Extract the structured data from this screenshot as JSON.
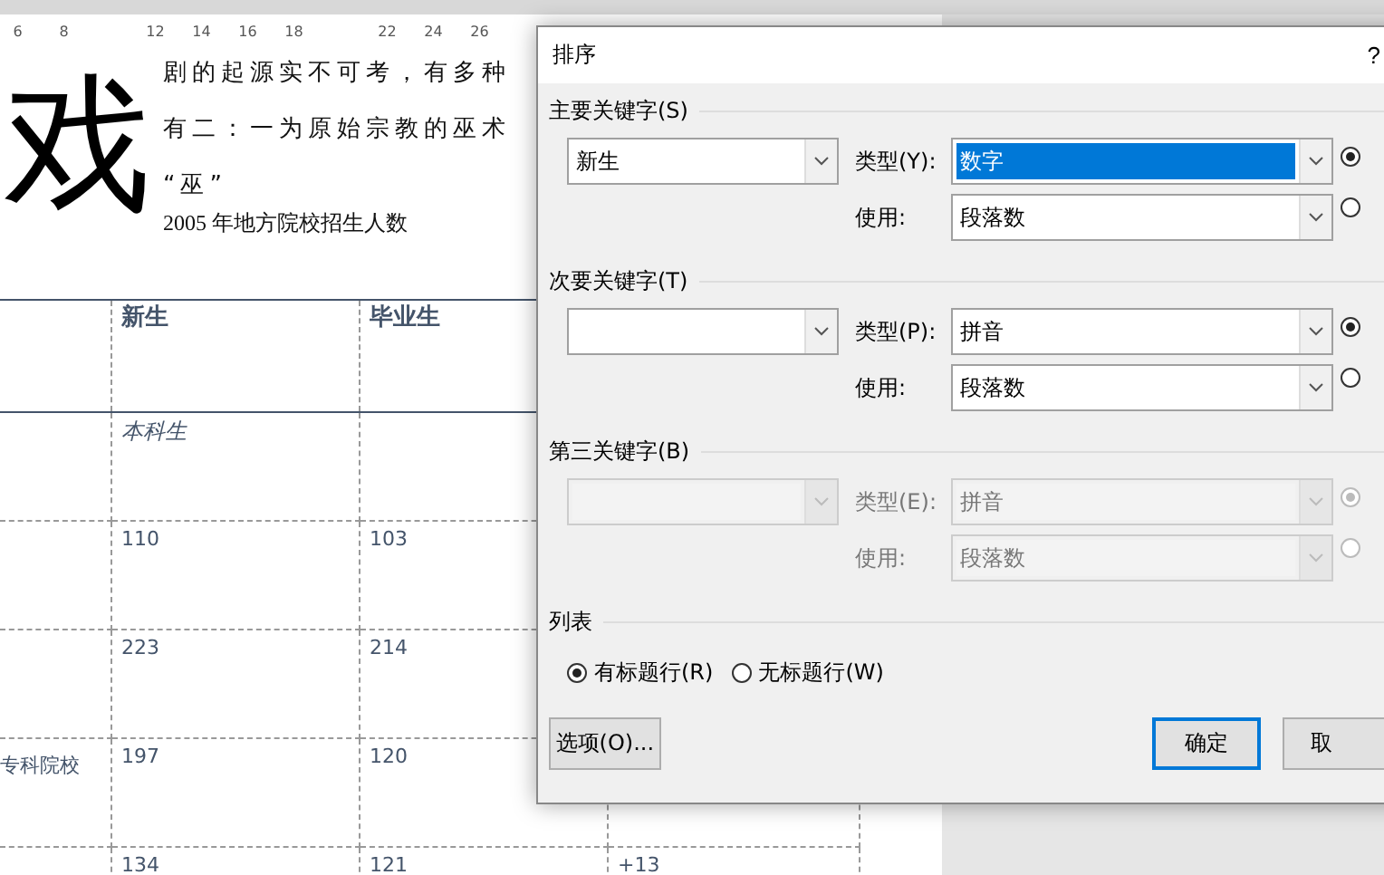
{
  "ruler": {
    "numbers": [
      "6",
      "8",
      "12",
      "14",
      "16",
      "18",
      "22",
      "24",
      "26"
    ]
  },
  "document": {
    "drop_cap": "戏",
    "lines": [
      "剧的起源实不可考，有多种",
      "有二：一为原始宗教的巫术",
      "“巫”"
    ],
    "caption": "2005 年地方院校招生人数",
    "table": {
      "rows": [
        {
          "kind": "header",
          "column_2": "新生",
          "column_3": "毕业生"
        },
        {
          "kind": "subheader",
          "column_2": "本科生"
        },
        {
          "kind": "data",
          "column_2": "110",
          "column_3": "103"
        },
        {
          "kind": "data",
          "column_2": "223",
          "column_3": "214"
        },
        {
          "kind": "data",
          "column_1": "专科院校",
          "column_2": "197",
          "column_3": "120"
        },
        {
          "kind": "data",
          "column_2": "134",
          "column_3": "121",
          "column_4": "+13"
        }
      ]
    }
  },
  "dialog": {
    "title": "排序",
    "help": "?",
    "sort_keys": [
      {
        "label": "主要关键字(S)",
        "disabled": false,
        "field": "新生",
        "type_label": "类型(Y):",
        "type_value": "数字",
        "type_highlighted": true,
        "using_label": "使用:",
        "using_value": "段落数",
        "order": [
          {
            "selected": true
          },
          {
            "selected": false
          }
        ]
      },
      {
        "label": "次要关键字(T)",
        "disabled": false,
        "type_label": "类型(P):",
        "type_value": "拼音",
        "type_highlighted": false,
        "using_label": "使用:",
        "using_value": "段落数",
        "order": [
          {
            "selected": true
          },
          {
            "selected": false
          }
        ]
      },
      {
        "label": "第三关键字(B)",
        "disabled": true,
        "type_label": "类型(E):",
        "type_value": "拼音",
        "type_highlighted": false,
        "using_label": "使用:",
        "using_value": "段落数",
        "order": [
          {
            "selected": true
          },
          {
            "selected": false
          }
        ]
      }
    ],
    "list_section": {
      "label": "列表",
      "options": [
        {
          "label": "有标题行(R)",
          "selected": true
        },
        {
          "label": "无标题行(W)",
          "selected": false
        }
      ]
    },
    "buttons": [
      {
        "label": "选项(O)...",
        "default": false
      },
      {
        "label": "确定",
        "default": true
      },
      {
        "label": "取",
        "default": false
      }
    ]
  }
}
